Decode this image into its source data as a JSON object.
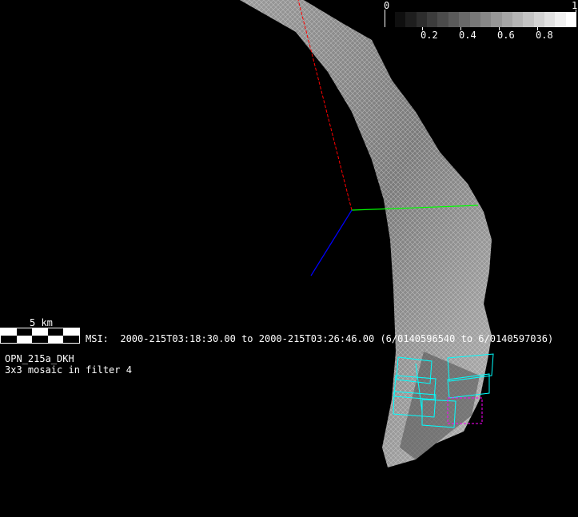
{
  "colorbar": {
    "min_label": "0",
    "max_label": "1",
    "ticks": [
      "0.2",
      "0.4",
      "0.6",
      "0.8"
    ],
    "steps": 17
  },
  "scale_bar": {
    "label": "5 km"
  },
  "msi_line": "MSI:  2000-215T03:18:30.00 to 2000-215T03:26:46.00 (6/0140596540 to 6/0140597036)",
  "sequence": {
    "name": "OPN_215a_DKH",
    "description": "3x3 mosaic in filter 4"
  },
  "colors": {
    "x_axis": "#ff0000",
    "y_axis": "#00ff00",
    "z_axis": "#0000ff",
    "footprint": "#00ffff",
    "current_footprint": "#ff00ff"
  }
}
